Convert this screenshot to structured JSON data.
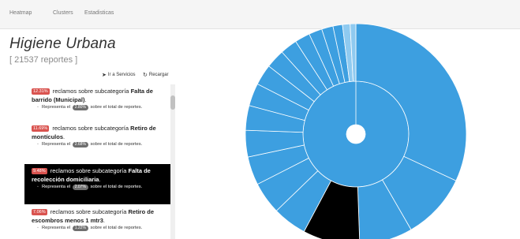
{
  "nav": {
    "items": [
      "Heatmap",
      "Clusters",
      "Estadisticas"
    ]
  },
  "header": {
    "title": "Higiene Urbana",
    "count": "[ 21537 reportes ]"
  },
  "actions": {
    "services_label": "Ir a Servicios",
    "reload_label": "Recargar"
  },
  "items": [
    {
      "pct": "12.31%",
      "text": "reclamos sobre subcategoría",
      "category": "Falta de barrido (Municipal)",
      "rep_before": "Representa el",
      "rep_value": "2.80%",
      "rep_after": "sobre el total de reportes.",
      "selected": false
    },
    {
      "pct": "11.69%",
      "text": "reclamos sobre subcategoría",
      "category": "Retiro de montículos",
      "rep_before": "Representa el",
      "rep_value": "2.68%",
      "rep_after": "sobre el total de reportes.",
      "selected": false
    },
    {
      "pct": "9.48%",
      "text": "reclamos sobre subcategoría",
      "category": "Falta de recolección domiciliaria",
      "rep_before": "Representa el",
      "rep_value": "2.07%",
      "rep_after": "sobre el total de reportes.",
      "selected": true
    },
    {
      "pct": "7.06%",
      "text": "reclamos sobre subcategoría",
      "category": "Retiro de escombros menos 1 mtr3",
      "rep_before": "Representa el",
      "rep_value": "1.22%",
      "rep_after": "sobre el total de reportes.",
      "selected": false
    }
  ],
  "colors": {
    "ring": "#3d9fe0",
    "highlight": "#000000",
    "border": "#ffffff",
    "badge_red": "#d9534f",
    "badge_gray": "#6f6f6f"
  }
}
